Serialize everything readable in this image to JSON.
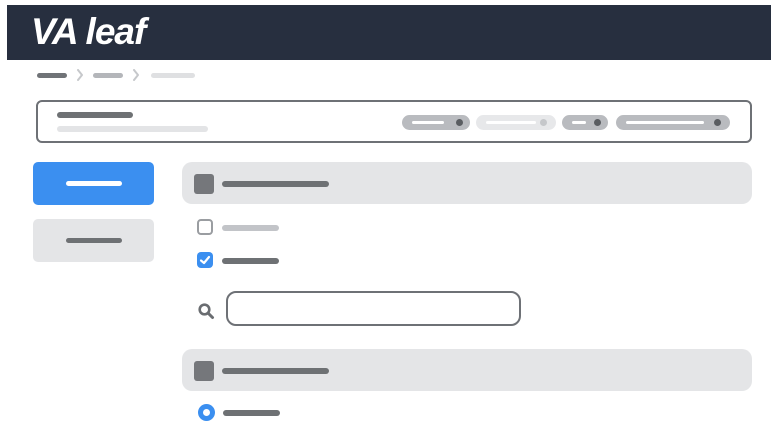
{
  "header": {
    "logo_text": "VA leaf"
  },
  "colors": {
    "header_bg": "#272f3f",
    "primary": "#3b8ff0",
    "panel_bg": "#e4e5e7",
    "placeholder_dark": "#6e7174",
    "placeholder_mid": "#b7b9bd",
    "placeholder_light": "#e3e4e6"
  },
  "icons": {
    "breadcrumb_separator": "chevron-right-icon",
    "search": "search-icon",
    "checkbox_checked": "check-icon",
    "radio_selected": "radio-selected-icon"
  },
  "filters": {
    "option_1_checked": false,
    "option_2_checked": true,
    "radio_1_selected": true
  }
}
